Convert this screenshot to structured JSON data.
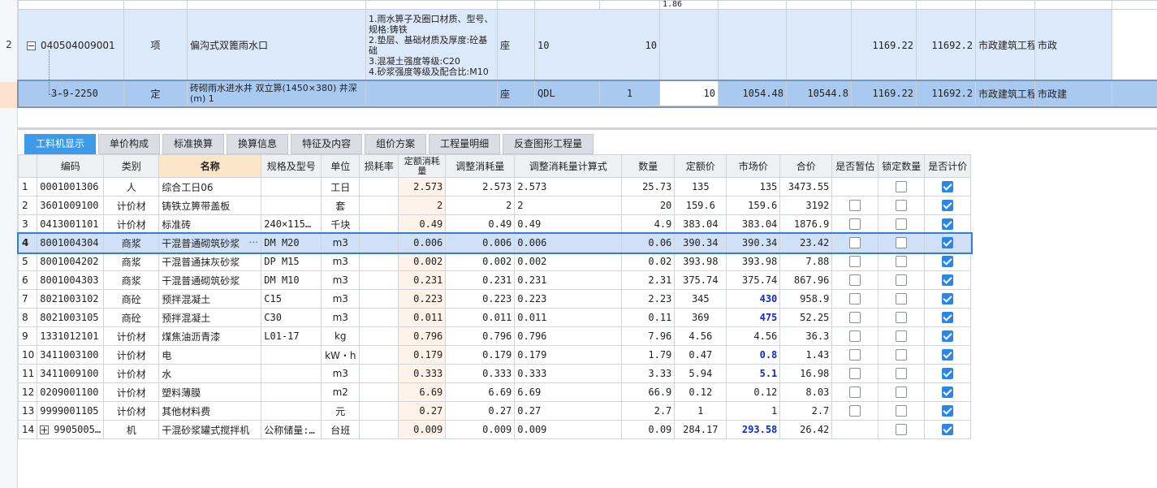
{
  "top_grid": {
    "partial_row": {
      "text": "1.86"
    },
    "rows": [
      {
        "idx": "2",
        "code": "040504009001",
        "category": "项",
        "name": "偏沟式双篦雨水口",
        "features": [
          "1.雨水箅子及圈口材质、型号、规格:铸铁",
          "2.垫层、基础材质及厚度:砼基础",
          "3.混凝土强度等级:C20",
          "4.砂浆强度等级及配合比:M10"
        ],
        "unit": "座",
        "expr": "10",
        "qty": "10",
        "col_a": "",
        "col_b": "",
        "unit_price": "1169.22",
        "total": "11692.2",
        "major": "市政建筑工程",
        "trail": "市政"
      },
      {
        "idx": "",
        "code": "3-9-2250",
        "category": "定",
        "name": "砖砌雨水进水井 双立箅(1450×380) 井深(m) 1",
        "features": [],
        "unit": "座",
        "expr": "QDL",
        "qty_coef": "1",
        "qty": "10",
        "col_a": "1054.48",
        "col_b": "10544.8",
        "unit_price": "1169.22",
        "total": "11692.2",
        "major": "市政建筑工程",
        "trail": "市政建"
      }
    ]
  },
  "tabs": [
    {
      "label": "工料机显示",
      "active": true
    },
    {
      "label": "单价构成"
    },
    {
      "label": "标准换算"
    },
    {
      "label": "换算信息"
    },
    {
      "label": "特征及内容"
    },
    {
      "label": "组价方案"
    },
    {
      "label": "工程量明细"
    },
    {
      "label": "反查图形工程量"
    }
  ],
  "grid": {
    "headers": [
      "编码",
      "类别",
      "名称",
      "规格及型号",
      "单位",
      "损耗率",
      "定额消耗量",
      "调整消耗量",
      "调整消耗量计算式",
      "数量",
      "定额价",
      "市场价",
      "合价",
      "是否暂估",
      "锁定数量",
      "是否计价"
    ],
    "rows": [
      {
        "idx": "1",
        "code": "0001001306",
        "type": "人",
        "name": "综合工日06",
        "spec": "",
        "unit": "工日",
        "loss": "",
        "quota": "2.573",
        "adj": "2.573",
        "expr": "2.573",
        "qty": "25.73",
        "qprice": "135",
        "mprice": "135",
        "total": "3473.55",
        "est": false,
        "lock": false,
        "price": true,
        "mp_blue": false,
        "est_show": false
      },
      {
        "idx": "2",
        "code": "3601009100",
        "type": "计价材",
        "name": "铸铁立箅带盖板",
        "spec": "",
        "unit": "套",
        "loss": "",
        "quota": "2",
        "adj": "2",
        "expr": "2",
        "qty": "20",
        "qprice": "159.6",
        "mprice": "159.6",
        "total": "3192",
        "est": false,
        "lock": false,
        "price": true,
        "mp_blue": false,
        "est_show": true
      },
      {
        "idx": "3",
        "code": "0413001101",
        "type": "计价材",
        "name": "标准砖",
        "spec": "240×115…",
        "unit": "千块",
        "loss": "",
        "quota": "0.49",
        "adj": "0.49",
        "expr": "0.49",
        "qty": "4.9",
        "qprice": "383.04",
        "mprice": "383.04",
        "total": "1876.9",
        "est": false,
        "lock": false,
        "price": true,
        "mp_blue": false,
        "est_show": true
      },
      {
        "idx": "4",
        "code": "8001004304",
        "type": "商浆",
        "name": "干混普通砌筑砂浆",
        "spec": "DM M20",
        "unit": "m3",
        "loss": "",
        "quota": "0.006",
        "adj": "0.006",
        "expr": "0.006",
        "qty": "0.06",
        "qprice": "390.34",
        "mprice": "390.34",
        "total": "23.42",
        "est": false,
        "lock": false,
        "price": true,
        "mp_blue": false,
        "est_show": true,
        "selected": true
      },
      {
        "idx": "5",
        "code": "8001004202",
        "type": "商浆",
        "name": "干混普通抹灰砂浆",
        "spec": "DP M15",
        "unit": "m3",
        "loss": "",
        "quota": "0.002",
        "adj": "0.002",
        "expr": "0.002",
        "qty": "0.02",
        "qprice": "393.98",
        "mprice": "393.98",
        "total": "7.88",
        "est": false,
        "lock": false,
        "price": true,
        "mp_blue": false,
        "est_show": true
      },
      {
        "idx": "6",
        "code": "8001004303",
        "type": "商浆",
        "name": "干混普通砌筑砂浆",
        "spec": "DM M10",
        "unit": "m3",
        "loss": "",
        "quota": "0.231",
        "adj": "0.231",
        "expr": "0.231",
        "qty": "2.31",
        "qprice": "375.74",
        "mprice": "375.74",
        "total": "867.96",
        "est": false,
        "lock": false,
        "price": true,
        "mp_blue": false,
        "est_show": true
      },
      {
        "idx": "7",
        "code": "8021003102",
        "type": "商砼",
        "name": "预拌混凝土",
        "spec": "C15",
        "unit": "m3",
        "loss": "",
        "quota": "0.223",
        "adj": "0.223",
        "expr": "0.223",
        "qty": "2.23",
        "qprice": "345",
        "mprice": "430",
        "total": "958.9",
        "est": false,
        "lock": false,
        "price": true,
        "mp_blue": true,
        "est_show": true
      },
      {
        "idx": "8",
        "code": "8021003105",
        "type": "商砼",
        "name": "预拌混凝土",
        "spec": "C30",
        "unit": "m3",
        "loss": "",
        "quota": "0.011",
        "adj": "0.011",
        "expr": "0.011",
        "qty": "0.11",
        "qprice": "369",
        "mprice": "475",
        "total": "52.25",
        "est": false,
        "lock": false,
        "price": true,
        "mp_blue": true,
        "est_show": true
      },
      {
        "idx": "9",
        "code": "1331012101",
        "type": "计价材",
        "name": "煤焦油沥青漆",
        "spec": "L01-17",
        "unit": "kg",
        "loss": "",
        "quota": "0.796",
        "adj": "0.796",
        "expr": "0.796",
        "qty": "7.96",
        "qprice": "4.56",
        "mprice": "4.56",
        "total": "36.3",
        "est": false,
        "lock": false,
        "price": true,
        "mp_blue": false,
        "est_show": true
      },
      {
        "idx": "10",
        "code": "3411003100",
        "type": "计价材",
        "name": "电",
        "spec": "",
        "unit": "kW・h",
        "loss": "",
        "quota": "0.179",
        "adj": "0.179",
        "expr": "0.179",
        "qty": "1.79",
        "qprice": "0.47",
        "mprice": "0.8",
        "total": "1.43",
        "est": false,
        "lock": false,
        "price": true,
        "mp_blue": true,
        "est_show": true
      },
      {
        "idx": "11",
        "code": "3411009100",
        "type": "计价材",
        "name": "水",
        "spec": "",
        "unit": "m3",
        "loss": "",
        "quota": "0.333",
        "adj": "0.333",
        "expr": "0.333",
        "qty": "3.33",
        "qprice": "5.94",
        "mprice": "5.1",
        "total": "16.98",
        "est": false,
        "lock": false,
        "price": true,
        "mp_blue": true,
        "est_show": true
      },
      {
        "idx": "12",
        "code": "0209001100",
        "type": "计价材",
        "name": "塑料薄膜",
        "spec": "",
        "unit": "m2",
        "loss": "",
        "quota": "6.69",
        "adj": "6.69",
        "expr": "6.69",
        "qty": "66.9",
        "qprice": "0.12",
        "mprice": "0.12",
        "total": "8.03",
        "est": false,
        "lock": false,
        "price": true,
        "mp_blue": false,
        "est_show": true
      },
      {
        "idx": "13",
        "code": "9999001105",
        "type": "计价材",
        "name": "其他材料费",
        "spec": "",
        "unit": "元",
        "loss": "",
        "quota": "0.27",
        "adj": "0.27",
        "expr": "0.27",
        "qty": "2.7",
        "qprice": "1",
        "mprice": "1",
        "total": "2.7",
        "est": false,
        "lock": false,
        "price": true,
        "mp_blue": false,
        "est_show": true
      },
      {
        "idx": "14",
        "code": "9905005…",
        "type": "机",
        "name": "干混砂浆罐式搅拌机",
        "spec": "公称储量:…",
        "unit": "台班",
        "loss": "",
        "quota": "0.009",
        "adj": "0.009",
        "expr": "0.009",
        "qty": "0.09",
        "qprice": "284.17",
        "mprice": "293.58",
        "total": "26.42",
        "est": false,
        "lock": false,
        "price": true,
        "mp_blue": true,
        "est_show": false,
        "expandable": true
      }
    ]
  },
  "colors": {
    "accent": "#3d9ae8",
    "selected_row": "#cfe0f7",
    "top_row_bg": "#dce9fa",
    "top_row_sel": "#a9caf0",
    "blue_text": "#0b29d8"
  }
}
